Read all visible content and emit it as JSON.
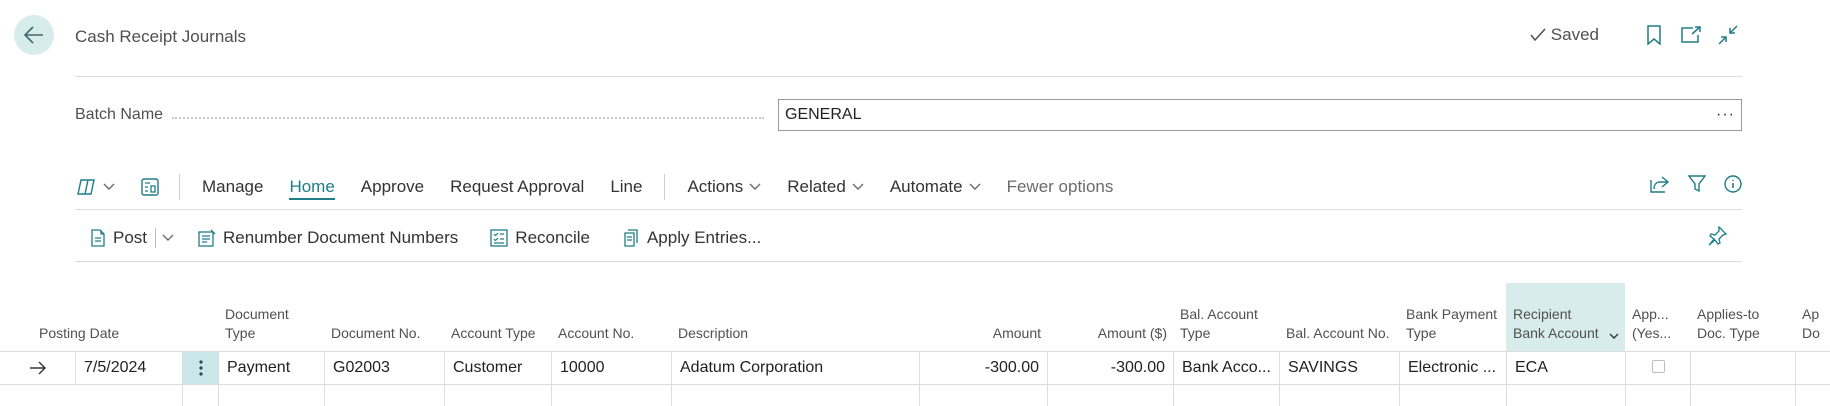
{
  "header": {
    "title": "Cash Receipt Journals",
    "saved_label": "Saved"
  },
  "batch": {
    "label": "Batch Name",
    "value": "GENERAL",
    "more": "···"
  },
  "actionbar": {
    "items": [
      "Manage",
      "Home",
      "Approve",
      "Request Approval",
      "Line"
    ],
    "active": "Home",
    "menus": [
      "Actions",
      "Related",
      "Automate"
    ],
    "fewer_options": "Fewer options"
  },
  "toolbar": {
    "post": "Post",
    "renumber": "Renumber Document Numbers",
    "reconcile": "Reconcile",
    "apply_entries": "Apply Entries..."
  },
  "columns": [
    "Posting Date",
    "Document Type",
    "Document No.",
    "Account Type",
    "Account No.",
    "Description",
    "Amount",
    "Amount ($)",
    "Bal. Account Type",
    "Bal. Account No.",
    "Bank Payment Type",
    "Recipient Bank Account",
    "App... (Yes...",
    "Applies-to Doc. Type",
    "Ap Do"
  ],
  "rows": [
    {
      "posting_date": "7/5/2024",
      "document_type": "Payment",
      "document_no": "G02003",
      "account_type": "Customer",
      "account_no": "10000",
      "description": "Adatum Corporation",
      "amount": "-300.00",
      "amount_lcy": "-300.00",
      "bal_account_type": "Bank Acco...",
      "bal_account_no": "SAVINGS",
      "bank_payment_type": "Electronic ...",
      "recipient_bank_account": "ECA"
    }
  ],
  "colors": {
    "accent": "#1f7d86",
    "selected_header": "#d9ecec"
  }
}
